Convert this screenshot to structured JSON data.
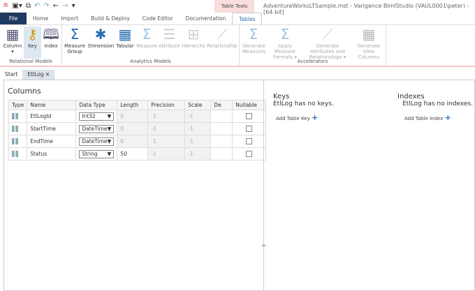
{
  "window": {
    "title": "AdventureWorksLTSample.mst - Varigence BimlStudio (VAUL0001\\peter) - [64-bit]",
    "context_tab": "Table Tools"
  },
  "ribbon_tabs": [
    "File",
    "Home",
    "Import",
    "Build & Deploy",
    "Code Editor",
    "Documentation",
    "Tables"
  ],
  "ribbon": {
    "groups": [
      {
        "label": "Relational Models",
        "buttons": [
          {
            "label": "Column",
            "icon": "column-grid-icon"
          },
          {
            "label": "Key",
            "icon": "key-icon"
          },
          {
            "label": "Index",
            "icon": "book-icon"
          }
        ]
      },
      {
        "label": "Analytics Models",
        "buttons": [
          {
            "label": "Measure Group",
            "icon": "sigma-icon"
          },
          {
            "label": "Dimension",
            "icon": "dimension-icon"
          },
          {
            "label": "Tabular",
            "icon": "tabular-icon"
          },
          {
            "label": "Measure",
            "icon": "sigma-icon"
          },
          {
            "label": "Attribute",
            "icon": "attribute-icon"
          },
          {
            "label": "Hierarchy",
            "icon": "hierarchy-icon"
          },
          {
            "label": "Relationship",
            "icon": "relationship-icon"
          }
        ]
      },
      {
        "label": "Accelerators",
        "buttons": [
          {
            "label": "Generate Measures",
            "icon": "sigma-icon"
          },
          {
            "label": "Apply Measure Formats ▾",
            "icon": "sigma-icon"
          },
          {
            "label": "Generate Attributes and Relationships ▾",
            "icon": "relationship-icon"
          },
          {
            "label": "Generate View Columns",
            "icon": "grid-icon"
          }
        ]
      }
    ]
  },
  "doc_tabs": [
    {
      "label": "Start"
    },
    {
      "label": "EtlLog",
      "close": "✕"
    }
  ],
  "columns": {
    "title": "Columns",
    "headers": [
      "Type",
      "Name",
      "Data Type",
      "Length",
      "Precision",
      "Scale",
      "De",
      "Nullable"
    ],
    "rows": [
      {
        "name": "EtlLogId",
        "data_type": "Int32",
        "length": "0",
        "precision": "-1",
        "scale": "-1",
        "nullable": false
      },
      {
        "name": "StartTime",
        "data_type": "DateTime",
        "length": "0",
        "precision": "-1",
        "scale": "-1",
        "nullable": false
      },
      {
        "name": "EndTime",
        "data_type": "DateTime",
        "length": "0",
        "precision": "-1",
        "scale": "-1",
        "nullable": false
      },
      {
        "name": "Status",
        "data_type": "String",
        "length": "50",
        "precision": "-1",
        "scale": "-1",
        "nullable": false
      }
    ]
  },
  "keys": {
    "title": "Keys",
    "message": "EtlLog has no keys.",
    "add": "Add Table Key"
  },
  "indexes": {
    "title": "Indexes",
    "message": "EtlLog has no indexes.",
    "add": "Add Table Index"
  }
}
